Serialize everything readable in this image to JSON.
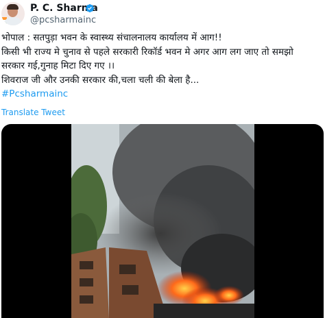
{
  "author": {
    "display_name": "P. C. Sharma",
    "handle": "@pcsharmainc",
    "verified": true,
    "icons": {
      "avatar": "profile-photo",
      "badge": "verified-badge-icon"
    }
  },
  "tweet": {
    "lines": [
      "भोपाल : सतपुड़ा भवन के स्वास्थ्य संचालनालय कार्यालय में आग!!",
      "किसी भी राज्य मे चुनाव से पहले सरकारी रिकॉर्ड भवन मे अगर आग लग जाए तो समझो",
      "सरकार गई,गुनाह मिटा दिए गए ।।",
      "शिवराज जी और उनकी सरकार की,चला चली की बेला है..."
    ],
    "hashtag": "#Pcsharmainc",
    "translate_label": "Translate Tweet"
  },
  "media": {
    "type": "video",
    "description_icon": "building-fire-video"
  },
  "colors": {
    "link": "#1d9bf0",
    "verified": "#1d9bf0",
    "muted": "#536471",
    "text": "#0f1419",
    "media_bg": "#000000"
  }
}
